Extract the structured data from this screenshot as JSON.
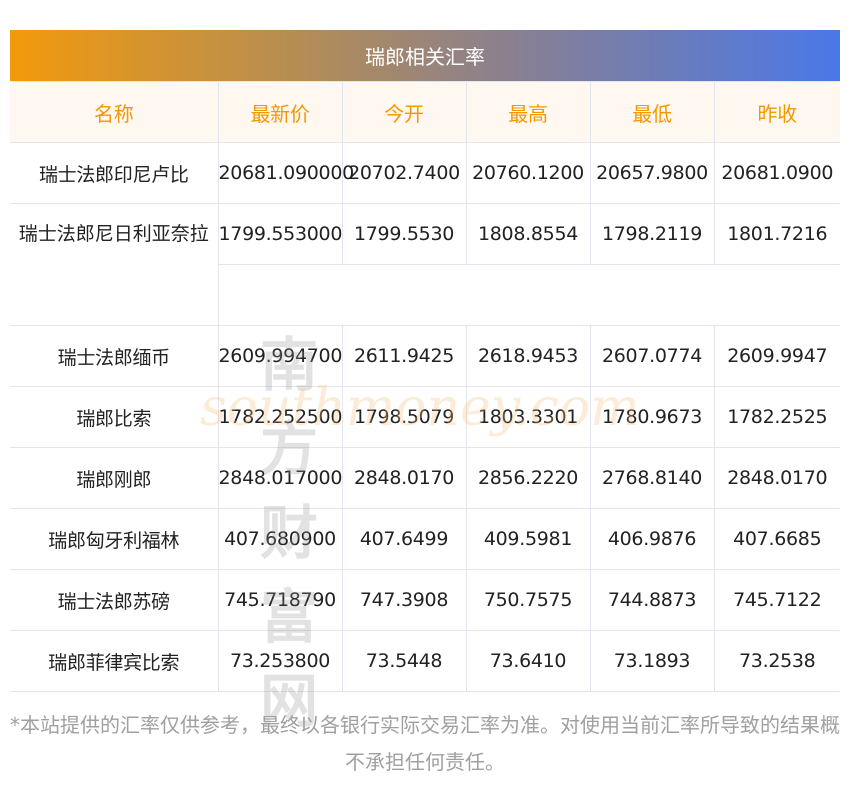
{
  "title": "瑞郎相关汇率",
  "headers": [
    "名称",
    "最新价",
    "今开",
    "最高",
    "最低",
    "昨收"
  ],
  "rows": [
    [
      "瑞士法郎印尼卢比",
      "20681.090000",
      "20702.7400",
      "20760.1200",
      "20657.9800",
      "20681.0900"
    ],
    [
      "瑞士法郎尼日利亚奈拉",
      "1799.553000",
      "1799.5530",
      "1808.8554",
      "1798.2119",
      "1801.7216"
    ],
    [
      "瑞士法郎缅币",
      "2609.994700",
      "2611.9425",
      "2618.9453",
      "2607.0774",
      "2609.9947"
    ],
    [
      "瑞郎比索",
      "1782.252500",
      "1798.5079",
      "1803.3301",
      "1780.9673",
      "1782.2525"
    ],
    [
      "瑞郎刚郎",
      "2848.017000",
      "2848.0170",
      "2856.2220",
      "2768.8140",
      "2848.0170"
    ],
    [
      "瑞郎匈牙利福林",
      "407.680900",
      "407.6499",
      "409.5981",
      "406.9876",
      "407.6685"
    ],
    [
      "瑞士法郎苏磅",
      "745.718790",
      "747.3908",
      "750.7575",
      "744.8873",
      "745.7122"
    ],
    [
      "瑞郎菲律宾比索",
      "73.253800",
      "73.5448",
      "73.6410",
      "73.1893",
      "73.2538"
    ]
  ],
  "watermark": {
    "cn": "南方财富网",
    "en": "southmoney.com"
  },
  "note": "*本站提供的汇率仅供参考，最终以各银行实际交易汇率为准。对使用当前汇率所导致的结果概不承担任何责任。"
}
